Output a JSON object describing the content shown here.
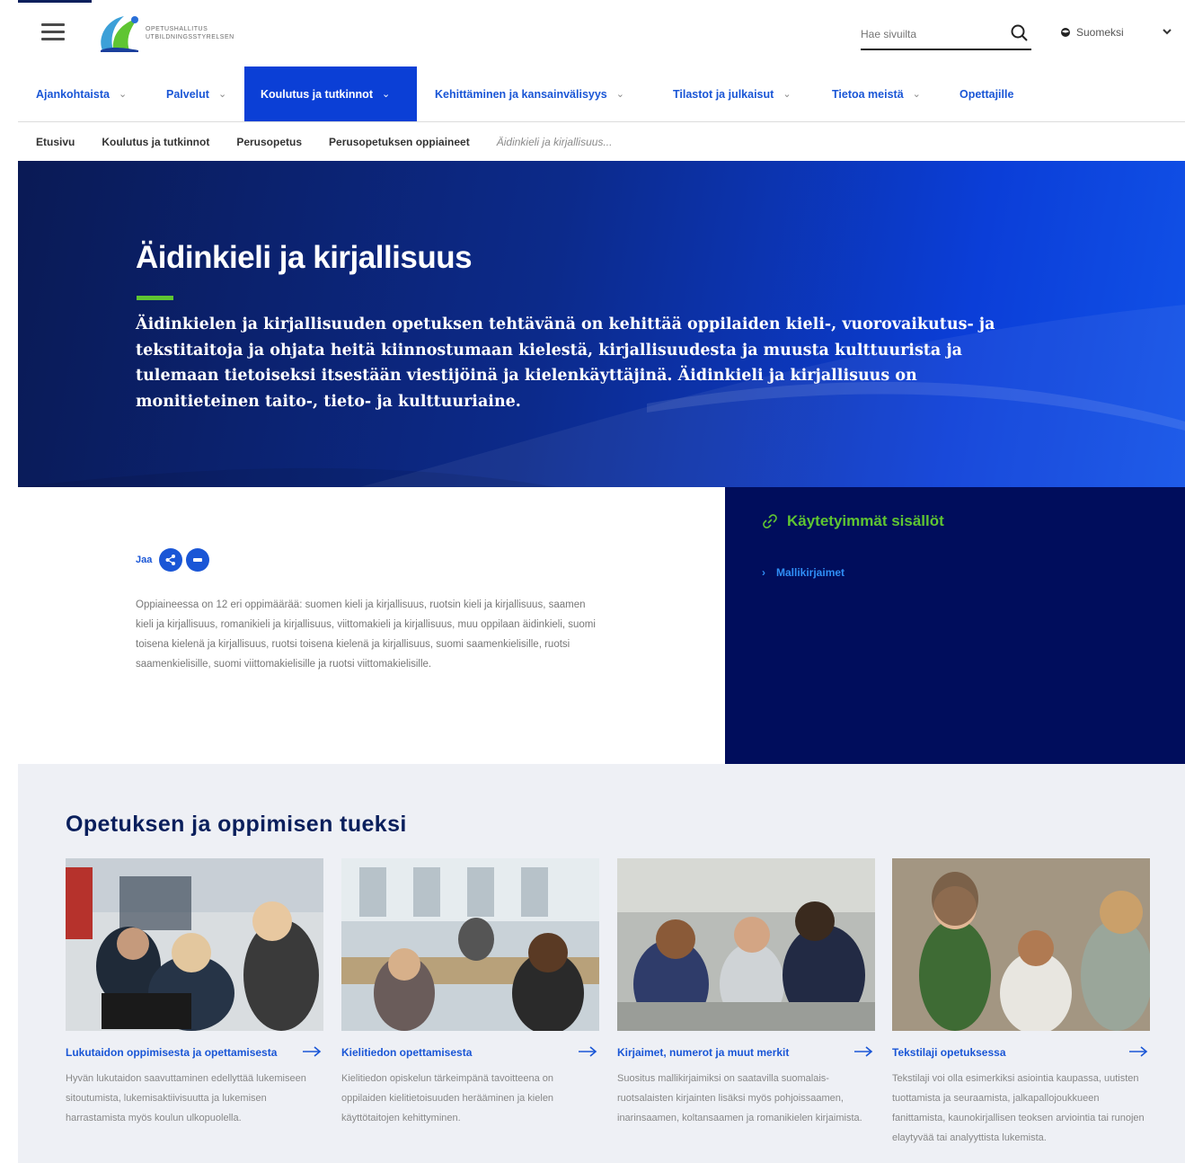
{
  "header": {
    "logo_text_line1": "Opetushallitus",
    "logo_text_line2": "Utbildningsstyrelsen",
    "search_placeholder": "Hae sivuilta",
    "language": "Suomeksi"
  },
  "nav": {
    "items": [
      {
        "label": "Ajankohtaista"
      },
      {
        "label": "Palvelut"
      },
      {
        "label": "Koulutus ja tutkinnot"
      },
      {
        "label": "Kehittäminen ja kansainvälisyys"
      },
      {
        "label": "Tilastot ja julkaisut"
      },
      {
        "label": "Tietoa meistä"
      },
      {
        "label": "Opettajille"
      }
    ],
    "active_index": 2
  },
  "breadcrumb": [
    "Etusivu",
    "Koulutus ja tutkinnot",
    "Perusopetus",
    "Perusopetuksen oppiaineet",
    "Äidinkieli ja kirjallisuus..."
  ],
  "hero": {
    "title": "Äidinkieli ja kirjallisuus",
    "lead": "Äidinkielen ja kirjallisuuden opetuksen tehtävänä on kehittää oppilaiden kieli-, vuorovaikutus- ja tekstitaitoja ja ohjata heitä kiinnostumaan kielestä, kirjallisuudesta ja muusta kulttuurista ja tulemaan tietoiseksi itsestään viestijöinä ja kielenkäyttäjinä. Äidinkieli ja kirjallisuus on monitieteinen taito-, tieto- ja kulttuuriaine."
  },
  "share": {
    "label": "Jaa"
  },
  "body_text": "Oppiaineessa on 12 eri oppimäärää: suomen kieli ja kirjallisuus, ruotsin kieli ja kirjallisuus, saamen kieli ja kirjallisuus, romanikieli ja kirjallisuus, viittomakieli ja kirjallisuus, muu oppilaan äidinkieli, suomi toisena kielenä ja kirjallisuus, ruotsi toisena kielenä ja kirjallisuus, suomi saamenkielisille, ruotsi saamenkielisille, suomi viittomakielisille ja ruotsi viittomakielisille.",
  "popular": {
    "title": "Käytetyimmät sisällöt",
    "links": [
      "Mallikirjaimet"
    ]
  },
  "support": {
    "title": "Opetuksen ja oppimisen tueksi",
    "cards": [
      {
        "title": "Lukutaidon oppimisesta ja opettamisesta",
        "text": "Hyvän lukutaidon saavuttaminen edellyttää lukemiseen sitoutumista, lukemisaktiivisuutta ja lukemisen harrastamista myös koulun ulkopuolella."
      },
      {
        "title": "Kielitiedon opettamisesta",
        "text": "Kielitiedon opiskelun tärkeimpänä tavoitteena on oppilaiden kielitietoisuuden herääminen ja kielen käyttötaitojen kehittyminen."
      },
      {
        "title": "Kirjaimet, numerot ja muut merkit",
        "text": "Suositus mallikirjaimiksi on saatavilla suomalais-ruotsalaisten kirjainten lisäksi myös pohjoissaamen, inarinsaamen, koltansaamen ja romanikielen kirjaimista."
      },
      {
        "title": "Tekstilaji opetuksessa",
        "text": "Tekstilaji voi olla esimerkiksi asiointia kaupassa, uutisten tuottamista ja seuraamista, jalkapallojoukkueen fanittamista, kaunokirjallisen teoksen arviointia tai runojen elaytyvää tai analyyttista lukemista."
      }
    ]
  },
  "colors": {
    "accent_blue": "#1a56d6",
    "active_nav": "#0b3fd6",
    "green": "#5fc532",
    "dark_navy": "#000d5c"
  }
}
